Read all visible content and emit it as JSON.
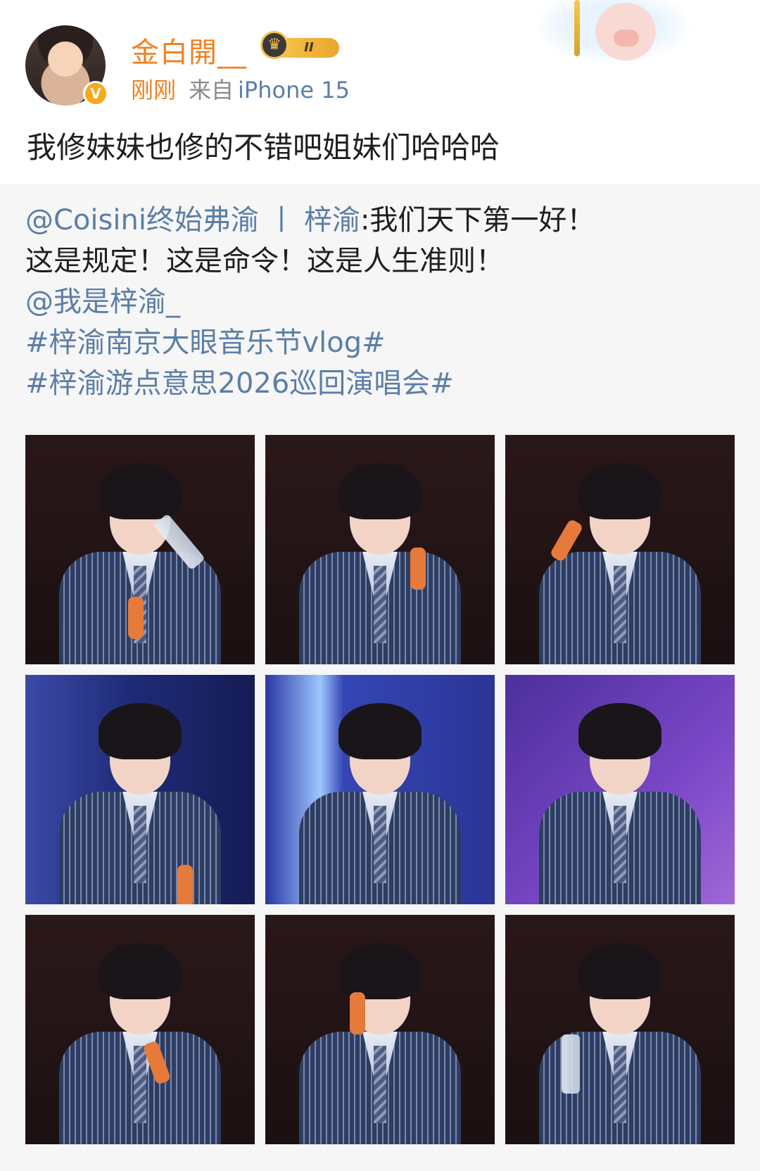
{
  "header": {
    "username": "金白開__",
    "level_badge": "II",
    "time": "刚刚",
    "source_prefix": "来自",
    "device": "iPhone 15",
    "verified_badge": "V"
  },
  "post": {
    "text": "我修妹妹也修的不错吧姐妹们哈哈哈"
  },
  "repost": {
    "author_mention": "@Coisini终始弗渝",
    "separator": "丨",
    "author_suffix": "梓渝",
    "line1_text": ":我们天下第一好！",
    "line2_text": "这是规定！这是命令！这是人生准则！",
    "mention2": "@我是梓渝_",
    "hashtag1": "#梓渝南京大眼音乐节vlog#",
    "hashtag2": "#梓渝游点意思2026巡回演唱会#"
  },
  "images": {
    "count": 9,
    "backgrounds": [
      "dark-maroon",
      "dark-maroon",
      "dark-maroon",
      "blue-stage",
      "blue-stage",
      "purple-stage",
      "dark-maroon",
      "dark-maroon",
      "dark-maroon"
    ]
  },
  "colors": {
    "username": "#f08022",
    "link": "#5b7fa6",
    "text": "#1f1f1f",
    "meta_gray": "#8a8a8a",
    "repost_bg": "#f6f6f6",
    "verified": "#f7a91a"
  },
  "icons": [
    "verified-badge-icon",
    "crown-level-icon",
    "pig-decoration-icon"
  ]
}
